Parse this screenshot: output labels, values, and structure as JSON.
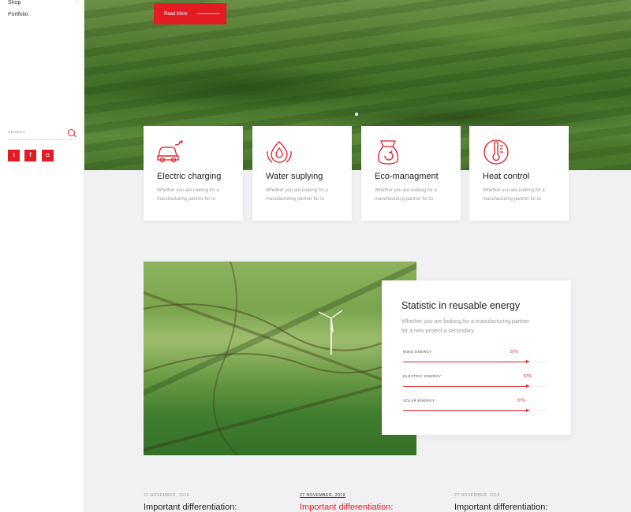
{
  "sidebar": {
    "menu": [
      {
        "label": "Shop",
        "has_submenu": true
      },
      {
        "label": "Portfolio",
        "has_submenu": false
      }
    ],
    "search": {
      "placeholder": "SEARCH"
    },
    "social": [
      {
        "icon": "twitter-icon",
        "glyph": "t"
      },
      {
        "icon": "facebook-icon",
        "glyph": "f"
      },
      {
        "icon": "instagram-icon",
        "glyph": "◘"
      }
    ]
  },
  "hero": {
    "button_label": "Read More",
    "slider_dots": 1
  },
  "services": [
    {
      "icon": "electric-car-icon",
      "title": "Electric charging",
      "desc": "Whether you are looking for a manufacturing partner for to"
    },
    {
      "icon": "water-drops-icon",
      "title": "Water suplying",
      "desc": "Whether you are looking for a manufacturing partner for to"
    },
    {
      "icon": "eco-bag-icon",
      "title": "Eco-managment",
      "desc": "Whether you are looking for a manufacturing partner for to"
    },
    {
      "icon": "thermometer-icon",
      "title": "Heat control",
      "desc": "Whether you are looking for a manufacturing partner for to"
    }
  ],
  "statistics": {
    "title": "Statistic in reusable energy",
    "desc": "Whether you are looking for a manufacturing partner for a new project a secondary",
    "bars": [
      {
        "label": "WIND ENERGY",
        "value_text": "87%",
        "value": 0.87
      },
      {
        "label": "ELECTRIC ENERGY",
        "value_text": "87%",
        "value": 0.87
      },
      {
        "label": "SOLAR ENERGY",
        "value_text": "87%",
        "value": 0.87
      }
    ]
  },
  "posts": [
    {
      "date": "27 NOVEMBER, 2019",
      "title": "Important differentiation:",
      "active": false
    },
    {
      "date": "27 NOVEMBER, 2019",
      "title": "Important differentiation:",
      "active": true
    },
    {
      "date": "27 NOVEMBER, 2019",
      "title": "Important differentiation:",
      "active": false
    }
  ],
  "colors": {
    "accent": "#e31b23",
    "background": "#f1f1f4"
  }
}
